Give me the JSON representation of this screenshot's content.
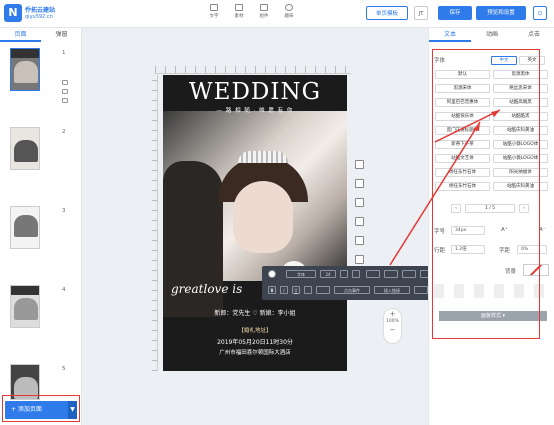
{
  "brand": {
    "logo_letter": "N",
    "name": "乔拓云建站",
    "url": "qiyu592.cn"
  },
  "toolbar": {
    "items": [
      {
        "label": "文字"
      },
      {
        "label": "素材"
      },
      {
        "label": "组件"
      },
      {
        "label": "趣味"
      }
    ]
  },
  "header_buttons": {
    "single_page_mode": "单页模板",
    "page_btn": "JT",
    "save": "保存",
    "preview": "预览和设置",
    "power": "⏻"
  },
  "left_panel": {
    "tabs": [
      "页面",
      "弹窗"
    ],
    "pages": [
      "1",
      "2",
      "3",
      "4",
      "5"
    ],
    "add_page": "+ 添加页面",
    "add_dropdown": "▼"
  },
  "poster": {
    "title": "WEDDING",
    "subtitle": "— 路 相 随 · 唯 愿 有 你",
    "script": "greatlove is",
    "names": "新郎：党先生  ♡  新娘：李小姐",
    "label": "【婚礼地址】",
    "date": "2019年05月20日11时30分",
    "venue": "广州市福田喜尔顿国际大酒店"
  },
  "floating_toolbar": {
    "font": "字体",
    "size": "24",
    "click_event": "点击事件",
    "insert_link": "插入链接"
  },
  "zoom": {
    "plus": "+",
    "value": "100%",
    "minus": "−"
  },
  "right_panel": {
    "tabs": [
      "文本",
      "动画",
      "点击"
    ],
    "font_label": "字体",
    "lang_toggle": [
      "中文",
      "英文"
    ],
    "fonts": [
      [
        "默认",
        "思源黑体"
      ],
      [
        "思源宋体",
        "络丝思宋体"
      ],
      [
        "阿里巴巴普惠体",
        "站酷高端黑"
      ],
      [
        "站酷快乐体",
        "站酷酷黑"
      ],
      [
        "庞门正道标题体",
        "站酷庆科黄油"
      ],
      [
        "新蒂下午茶",
        "站酷小薇LOGO体"
      ],
      [
        "站酷文艺体",
        "站酷小薇LOGO体"
      ],
      [
        "杨任东竹石体",
        "阳光纳福体"
      ],
      [
        "杨任东竹石体",
        "站酷庆科黄油"
      ]
    ],
    "pagination": {
      "prev": "‹",
      "page": "1 / 5",
      "next": "›"
    },
    "size_label": "字号",
    "size_value": "34px",
    "line_height_label": "行距",
    "line_height_value": "1.2倍",
    "letter_spacing_label": "字距",
    "letter_spacing_value": "0%",
    "bg_label": "背景",
    "apply_button": "画板样式 ▾",
    "accent_color": "#2f7bea",
    "highlight_color": "#e53935"
  }
}
